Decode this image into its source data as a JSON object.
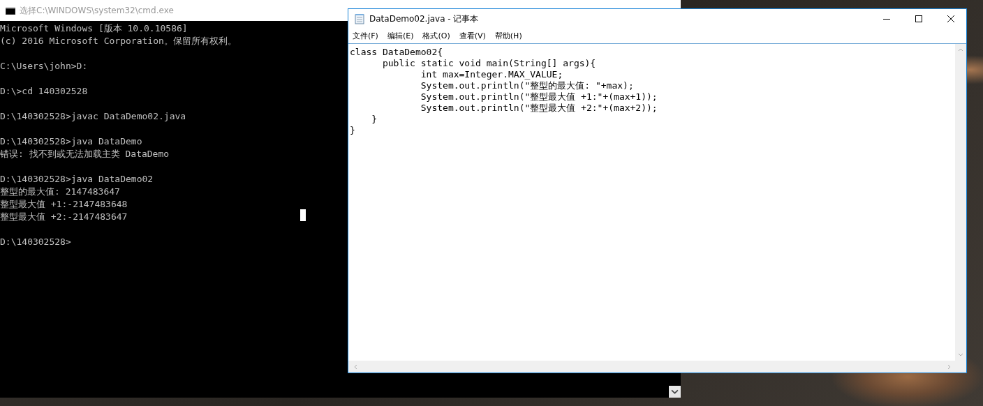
{
  "console_window": {
    "title": "选择C:\\WINDOWS\\system32\\cmd.exe",
    "blocks": [
      [
        "Microsoft Windows [版本 10.0.10586]",
        "(c) 2016 Microsoft Corporation。保留所有权利。"
      ],
      [
        "C:\\Users\\john>D:"
      ],
      [
        "D:\\>cd 140302528"
      ],
      [
        "D:\\140302528>javac DataDemo02.java"
      ],
      [
        "D:\\140302528>java DataDemo",
        "错误: 找不到或无法加载主类 DataDemo"
      ],
      [
        "D:\\140302528>java DataDemo02",
        "整型的最大值: 2147483647",
        "整型最大值 +1:-2147483648",
        "整型最大值 +2:-2147483647"
      ],
      [
        "D:\\140302528>"
      ]
    ]
  },
  "notepad_window": {
    "title": "DataDemo02.java - 记事本",
    "menu": [
      "文件(F)",
      "编辑(E)",
      "格式(O)",
      "查看(V)",
      "帮助(H)"
    ],
    "lines": [
      "class DataDemo02{",
      "      public static void main(String[] args){",
      "             int max=Integer.MAX_VALUE;",
      "             System.out.println(\"整型的最大值: \"+max);",
      "             System.out.println(\"整型最大值 +1:\"+(max+1));",
      "             System.out.println(\"整型最大值 +2:\"+(max+2));",
      "    }",
      "}"
    ]
  }
}
